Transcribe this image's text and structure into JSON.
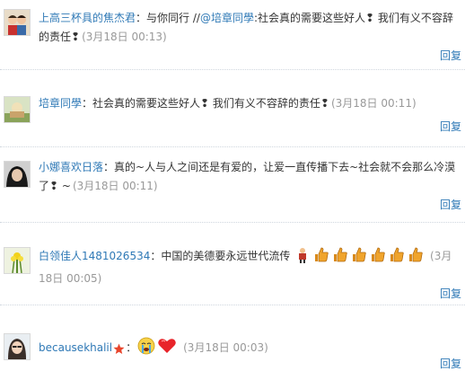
{
  "posts": [
    {
      "user": "上高三杯具的焦杰君",
      "sep": "：",
      "pre": "与你同行 //",
      "mention": "@培章同學",
      "text": ":社会真的需要这些好人❢ 我们有义不容辞的责任❢",
      "time": "(3月18日 00:13)",
      "reply": "回复"
    },
    {
      "user": "培章同學",
      "sep": "：",
      "text": "社会真的需要这些好人❢ 我们有义不容辞的责任❢",
      "time": "(3月18日 00:11)",
      "reply": "回复"
    },
    {
      "user": "小娜喜欢日落",
      "sep": "：",
      "text": "真的~人与人之间还是有爱的，让爱一直传播下去~社会就不会那么冷漠了❢ ~",
      "time": "(3月18日 00:11)",
      "reply": "回复"
    },
    {
      "user": "白领佳人1481026534",
      "sep": "：",
      "text": "中国的美德要永远世代流传",
      "time": "(3月18日 00:05)",
      "reply": "回复",
      "emoticons": [
        "person-icon",
        "thumbs-up-icon",
        "thumbs-up-icon",
        "thumbs-up-icon",
        "thumbs-up-icon",
        "thumbs-up-icon",
        "thumbs-up-icon"
      ]
    },
    {
      "user": "becausekhalil",
      "badge_icon": "star-badge-icon",
      "sep": "：",
      "text": "",
      "time": "(3月18日 00:03)",
      "reply": "回复",
      "emoticons": [
        "crying-face-icon",
        "heart-icon"
      ]
    }
  ],
  "colors": {
    "link": "#2f79b6",
    "time": "#999999",
    "text": "#333333",
    "divider": "#cfd6de"
  }
}
